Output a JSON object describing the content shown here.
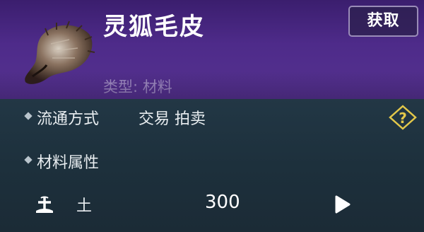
{
  "item": {
    "name": "灵狐毛皮",
    "type_label": "类型: 材料",
    "icon": "fox-fur-icon"
  },
  "actions": {
    "obtain_label": "获取"
  },
  "circulation": {
    "label": "流通方式",
    "value": "交易 拍卖",
    "help_icon": "question-diamond-icon"
  },
  "attributes": {
    "section_label": "材料属性",
    "element_name": "土",
    "element_value": "300",
    "element_icon": "earth-element-icon",
    "play_icon": "play-icon"
  },
  "colors": {
    "header": "#4e2b8a",
    "body": "#1f323e",
    "help_icon": "#e3c84a"
  }
}
